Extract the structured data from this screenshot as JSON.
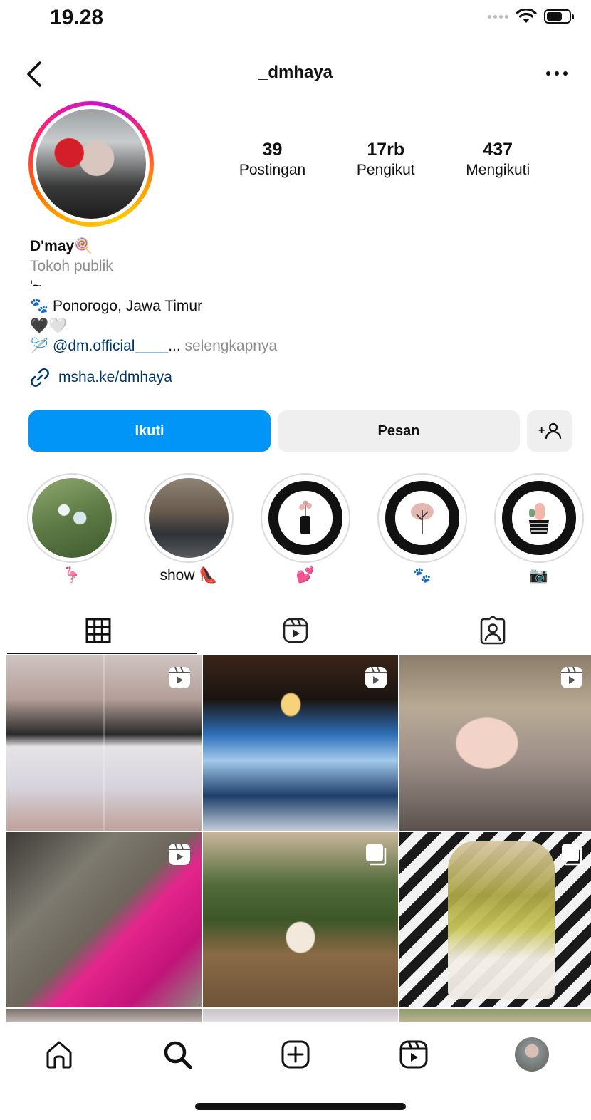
{
  "status_bar": {
    "time": "19.28"
  },
  "header": {
    "username": "_dmhaya",
    "back_icon": "chevron-left-icon",
    "more_icon": "ellipsis-icon"
  },
  "stats": [
    {
      "value": "39",
      "label": "Postingan"
    },
    {
      "value": "17rb",
      "label": "Pengikut"
    },
    {
      "value": "437",
      "label": "Mengikuti"
    }
  ],
  "bio": {
    "name": "D'may",
    "name_emoji": "🍭",
    "category": "Tokoh publik",
    "line1": "'~",
    "paw": "🐾",
    "location": "Ponorogo, Jawa Timur",
    "hearts": "🖤🤍",
    "needle": "🪡",
    "mention": "@dm.official____",
    "ellipsis": "...",
    "more": "selengkapnya"
  },
  "link": {
    "text": "msha.ke/dmhaya",
    "icon": "link-icon"
  },
  "buttons": {
    "follow": "Ikuti",
    "message": "Pesan",
    "add_user": "+"
  },
  "highlights": [
    {
      "label": "🦩"
    },
    {
      "label": "show 👠"
    },
    {
      "label": "💕"
    },
    {
      "label": "🐾"
    },
    {
      "label": "📷"
    }
  ],
  "tabs": [
    {
      "name": "grid",
      "icon": "grid-icon"
    },
    {
      "name": "reels",
      "icon": "reels-icon"
    },
    {
      "name": "tagged",
      "icon": "tagged-icon"
    }
  ],
  "nav": [
    {
      "icon": "home-icon"
    },
    {
      "icon": "search-icon"
    },
    {
      "icon": "create-icon"
    },
    {
      "icon": "reels-icon"
    },
    {
      "icon": "profile-avatar"
    }
  ],
  "colors": {
    "accent": "#0095f6",
    "link": "#00376b",
    "muted": "#8e8e8e"
  }
}
